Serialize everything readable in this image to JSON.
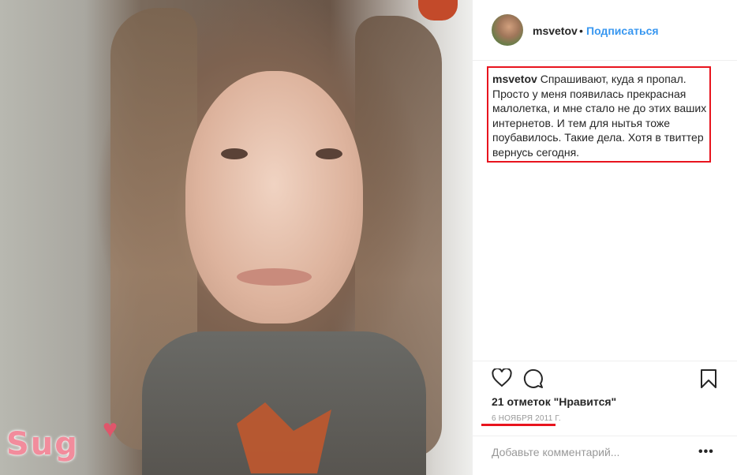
{
  "header": {
    "username": "msvetov",
    "separator": "•",
    "follow_label": "Подписаться"
  },
  "caption": {
    "username": "msvetov",
    "text": "Спрашивают, куда я пропал. Просто у меня появилась прекрасная малолетка, и мне стало не до этих ваших интернетов. И тем для нытья тоже поубавилось. Такие дела. Хотя в твиттер вернусь сегодня."
  },
  "photo": {
    "sticker_text": "Sug",
    "sticker_heart": "♥"
  },
  "actions": {
    "icons": [
      "heart-icon",
      "comment-icon",
      "bookmark-icon"
    ],
    "likes_text": "21 отметок \"Нравится\"",
    "date": "6 НОЯБРЯ 2011 Г."
  },
  "comment": {
    "placeholder": "Добавьте комментарий...",
    "more_label": "•••"
  },
  "colors": {
    "accent": "#3897f0",
    "highlight": "#e8141e",
    "text": "#262626",
    "muted": "#999999"
  }
}
